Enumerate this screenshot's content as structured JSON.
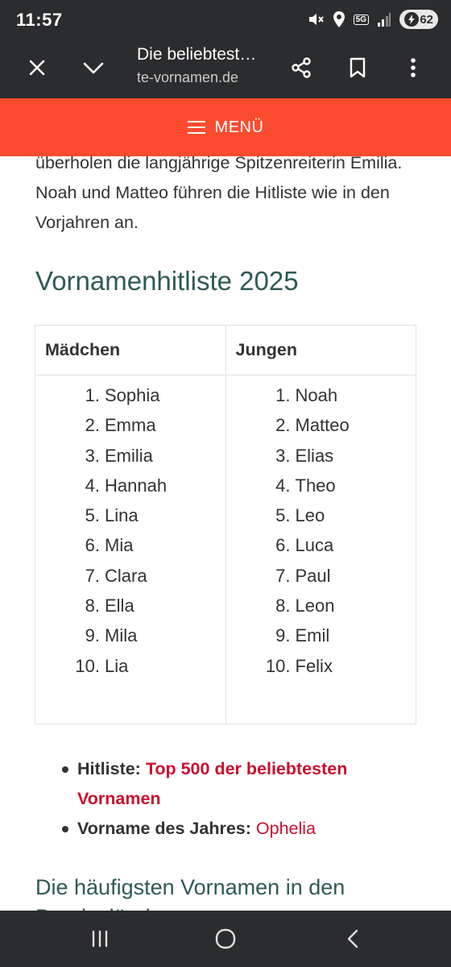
{
  "status_bar": {
    "time": "11:57",
    "network_badge": "5G",
    "battery_level": "62",
    "icons": [
      "mute-icon",
      "location-icon",
      "signal-icon",
      "battery-icon"
    ]
  },
  "browser": {
    "page_title": "Die beliebtest…",
    "url": "te-vornamen.de",
    "icons": [
      "close-icon",
      "chevron-down-icon",
      "share-icon",
      "bookmark-icon",
      "more-vert-icon"
    ]
  },
  "site_menu": {
    "label": "MENÜ",
    "accent_color": "#fc4c2f"
  },
  "article": {
    "intro": "überholen die langjährige Spitzenreiterin Emilia. Noah und Matteo führen die Hitliste wie in den Vorjahren an.",
    "section_heading": "Vornamenhitliste 2025",
    "table": {
      "headers": [
        "Mädchen",
        "Jungen"
      ],
      "girls": [
        {
          "rank": "1.",
          "name": "Sophia"
        },
        {
          "rank": "2.",
          "name": "Emma"
        },
        {
          "rank": "3.",
          "name": "Emilia"
        },
        {
          "rank": "4.",
          "name": "Hannah"
        },
        {
          "rank": "5.",
          "name": "Lina"
        },
        {
          "rank": "6.",
          "name": "Mia"
        },
        {
          "rank": "7.",
          "name": "Clara"
        },
        {
          "rank": "8.",
          "name": "Ella"
        },
        {
          "rank": "9.",
          "name": "Mila"
        },
        {
          "rank": "10.",
          "name": "Lia"
        }
      ],
      "boys": [
        {
          "rank": "1.",
          "name": "Noah"
        },
        {
          "rank": "2.",
          "name": "Matteo"
        },
        {
          "rank": "3.",
          "name": "Elias"
        },
        {
          "rank": "4.",
          "name": "Theo"
        },
        {
          "rank": "5.",
          "name": "Leo"
        },
        {
          "rank": "6.",
          "name": "Luca"
        },
        {
          "rank": "7.",
          "name": "Paul"
        },
        {
          "rank": "8.",
          "name": "Leon"
        },
        {
          "rank": "9.",
          "name": "Emil"
        },
        {
          "rank": "10.",
          "name": "Felix"
        }
      ]
    },
    "bullets": [
      {
        "label": "Hitliste:",
        "link": "Top 500 der beliebtesten Vornamen"
      },
      {
        "label": "Vorname des Jahres:",
        "link": "Ophelia"
      }
    ],
    "sub_heading": "Die häufigsten Vornamen in den Bundesländern",
    "link_color": "#c8102e",
    "heading_color": "#2e5a55"
  },
  "nav_bar": {
    "icons": [
      "recent-apps-icon",
      "home-icon",
      "back-icon"
    ]
  }
}
